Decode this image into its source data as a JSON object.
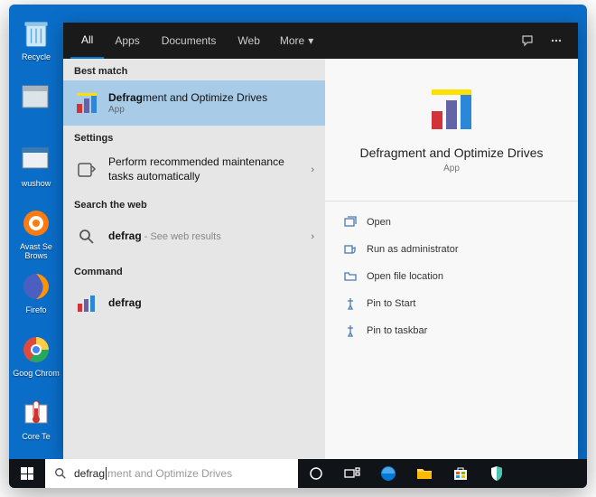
{
  "desktop": {
    "icons": [
      {
        "label": "Recycle"
      },
      {
        "label": ""
      },
      {
        "label": "wushow"
      },
      {
        "label": "Avast Se Brows"
      },
      {
        "label": "Firefo"
      },
      {
        "label": "Goog Chrom"
      },
      {
        "label": "Core Te"
      }
    ]
  },
  "search": {
    "tabs": {
      "all": "All",
      "apps": "Apps",
      "documents": "Documents",
      "web": "Web",
      "more": "More"
    },
    "categories": {
      "best_match": "Best match",
      "settings": "Settings",
      "search_web": "Search the web",
      "command": "Command"
    },
    "results": {
      "best": {
        "title_bold": "Defrag",
        "title_rest": "ment and Optimize Drives",
        "sub": "App"
      },
      "setting": {
        "title": "Perform recommended maintenance tasks automatically"
      },
      "web": {
        "title_bold": "defrag",
        "hint": " - See web results"
      },
      "command": {
        "title_bold": "defrag"
      }
    },
    "detail": {
      "title": "Defragment and Optimize Drives",
      "sub": "App",
      "actions": {
        "open": "Open",
        "admin": "Run as administrator",
        "location": "Open file location",
        "pin_start": "Pin to Start",
        "pin_taskbar": "Pin to taskbar"
      }
    }
  },
  "taskbar": {
    "search_value": "defrag",
    "search_placeholder_rest": "ment and Optimize Drives"
  }
}
